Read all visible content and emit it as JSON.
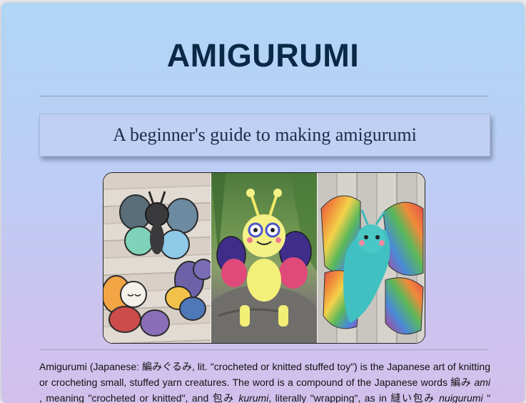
{
  "page": {
    "title": "AMIGURUMI",
    "subtitle": "A beginner's guide to making amigurumi"
  },
  "gallery": {
    "images": [
      "butterfly-amigurumi-photo-1",
      "butterfly-amigurumi-photo-2",
      "butterfly-amigurumi-photo-3"
    ]
  },
  "intro": {
    "p1": "Amigurumi (Japanese: ",
    "jp1": "編みぐるみ",
    "p2": ", lit. \"crocheted or knitted stuffed toy\") is the Japanese art of knitting or crocheting small, stuffed yarn creatures. The word is a compound of the Japanese words ",
    "jp2": "編み",
    "ami": "ami",
    "p3": " , meaning \"crocheted or knitted\", and ",
    "jp3": "包み",
    "kurumi": "kurumi",
    "p4": ", literally \"wrapping\", as in ",
    "jp4": "縫い包み",
    "nuigurumi": "nuigurumi",
    "p5": " \"(sewn)"
  },
  "colors": {
    "title": "#0b2947",
    "gradient_top": "#b0d6f6",
    "gradient_bottom": "#d3c0ec"
  }
}
